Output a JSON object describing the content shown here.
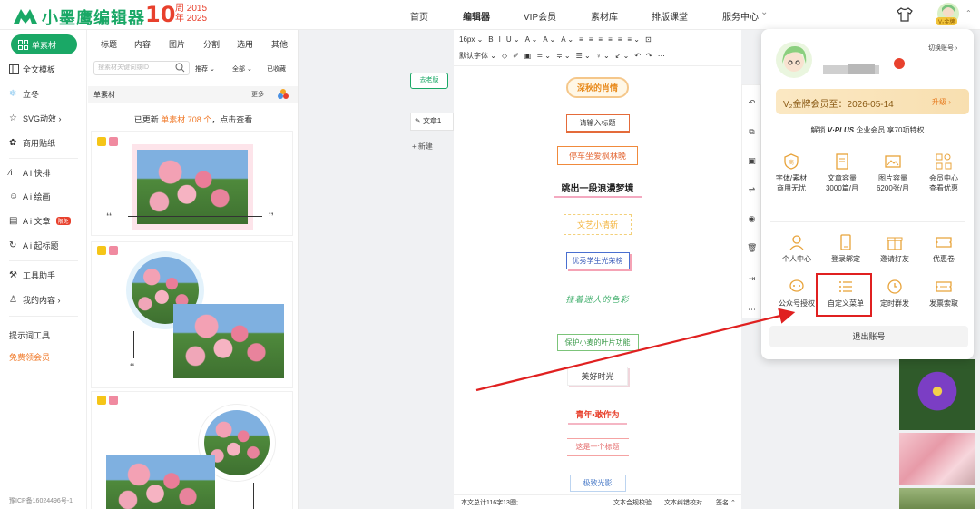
{
  "header": {
    "logo_text": "小墨鹰编辑器",
    "anniv_number": "10",
    "anniv_line1": "周 2015",
    "anniv_line2": "年 2025",
    "nav": [
      "首页",
      "编辑器",
      "VIP会员",
      "素材库",
      "排版课堂",
      "服务中心"
    ],
    "nav_caret": "⌄",
    "vip_mini": "V₂金牌"
  },
  "sidebar": {
    "items": [
      {
        "label": "单素材",
        "icon": "grid-icon"
      },
      {
        "label": "全文模板",
        "icon": "template-icon"
      },
      {
        "label": "立冬",
        "icon": "snowflake-icon"
      },
      {
        "label": "SVG动效 ›",
        "icon": "star-icon"
      },
      {
        "label": "商用贴纸",
        "icon": "sticker-icon"
      },
      {
        "label": "A i 快排",
        "icon": "ai-icon"
      },
      {
        "label": "A i 绘画",
        "icon": "palette-icon"
      },
      {
        "label": "A i 文章",
        "icon": "doc-icon",
        "badge": "限免"
      },
      {
        "label": "A i 起标题",
        "icon": "title-icon"
      },
      {
        "label": "工具助手",
        "icon": "tool-icon"
      },
      {
        "label": "我的内容 ›",
        "icon": "user-icon"
      }
    ],
    "prompt_tools": "提示词工具",
    "free_vip": "免费领会员",
    "icp": "豫ICP备16024496号-1"
  },
  "panel": {
    "tabs": [
      "标题",
      "内容",
      "图片",
      "分割",
      "选用",
      "其他"
    ],
    "search_placeholder": "搜素材关键词或ID",
    "filters": [
      "推荐 ⌄",
      "全部 ⌄",
      "已收藏"
    ],
    "header_title": "单素材",
    "header_more": "更多",
    "update_prefix": "已更新 ",
    "update_highlight": "单素材 708 个",
    "update_suffix": "，点击查看"
  },
  "canvas": {
    "old_version": "去老版",
    "article_tab": "文章1",
    "new_label": "+ 新建"
  },
  "toolbar": {
    "row1": [
      "16px ⌄",
      "B",
      "I",
      "U ⌄",
      "A ⌄",
      "A ⌄",
      "A ⌄",
      "≡",
      "≡",
      "≡",
      "≡",
      "≡",
      "≡ ⌄",
      "⊡"
    ],
    "row2": [
      "默认字体 ⌄",
      "◇",
      "✐",
      "▣",
      "≐ ⌄",
      "≑ ⌄",
      "☰ ⌄",
      "♀ ⌄",
      "↙ ⌄",
      "↶",
      "↷",
      "⋯"
    ]
  },
  "editor": {
    "items": [
      "深秋的肖情",
      "请输入标题",
      "停车坐爱枫林晚",
      "跳出一段浪漫梦境",
      "文艺小清新",
      "优秀学生光荣榜",
      "挂着迷人的色彩",
      "保护小麦的叶片功能",
      "美好时光",
      "青年•敢作为",
      "这是一个标题",
      "极致光影"
    ]
  },
  "status": {
    "count": "本文总计116字13图;",
    "check1": "文本合规校验",
    "check2": "文本纠错校对",
    "sign": "签名 ⌃"
  },
  "popup": {
    "switch_account": "切换账号 ›",
    "vip_text": "V₂金牌会员至：2026-05-14",
    "upgrade": "升级 ›",
    "unlock_prefix": "解锁 ",
    "unlock_brand": "V·PLUS",
    "unlock_suffix": " 企业会员 享70项特权",
    "benefits": [
      {
        "l1": "字体/素材",
        "l2": "商用无忧"
      },
      {
        "l1": "文章容量",
        "l2": "3000篇/月"
      },
      {
        "l1": "图片容量",
        "l2": "6200张/月"
      },
      {
        "l1": "会员中心",
        "l2": "查看优惠"
      }
    ],
    "actions": [
      "个人中心",
      "登录绑定",
      "邀请好友",
      "优惠卷",
      "公众号授权",
      "自定义菜单",
      "定时群发",
      "发票索取"
    ],
    "logout": "退出账号"
  },
  "colors": {
    "brand_green": "#1aa866",
    "accent_red": "#e8412d",
    "vip_gold": "#f8dfb0",
    "highlight": "#e02020"
  }
}
